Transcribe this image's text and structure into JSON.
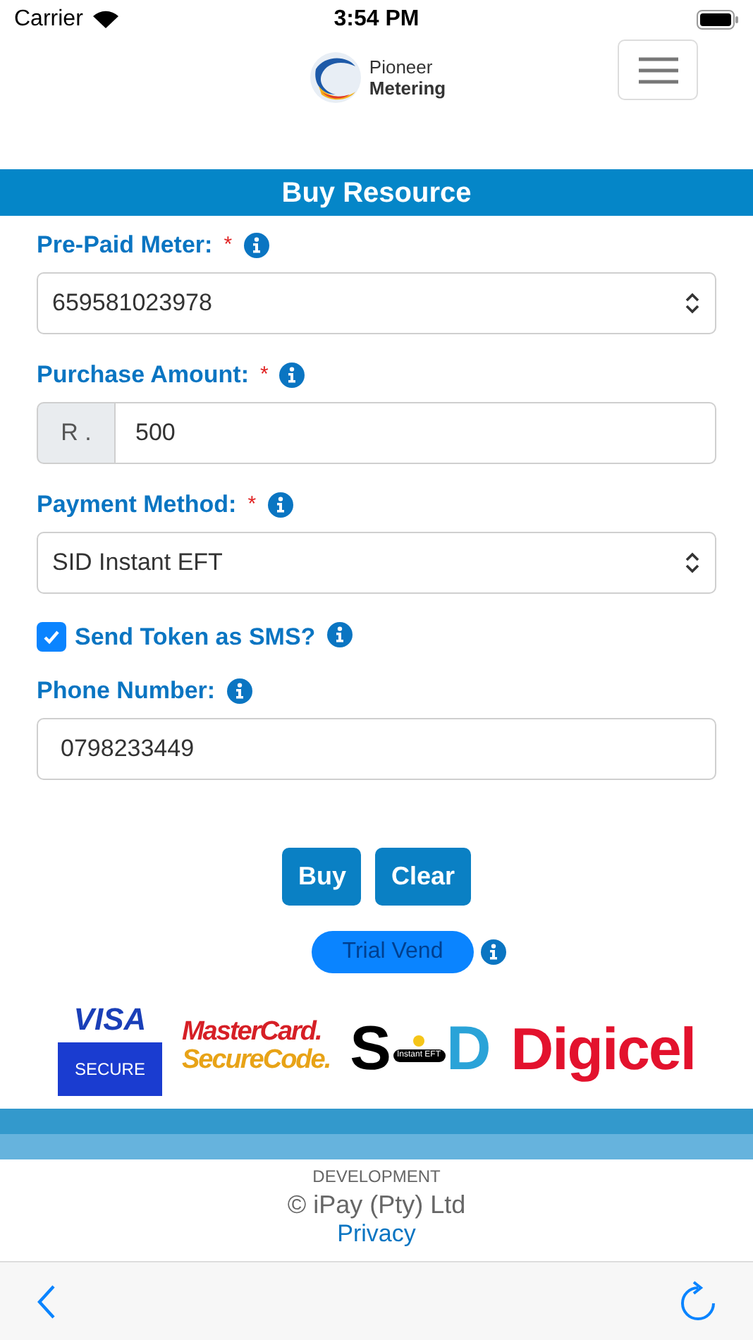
{
  "status_bar": {
    "carrier": "Carrier",
    "time": "3:54 PM"
  },
  "header": {
    "brand_top": "Pioneer",
    "brand_bottom": "Metering"
  },
  "title": "Buy Resource",
  "fields": [
    {
      "kind": "select",
      "label": "Pre-Paid Meter:",
      "required_mark": "*",
      "value": "659581023978"
    },
    {
      "kind": "prefix",
      "label": "Purchase Amount:",
      "required_mark": "*",
      "prefix": "R .",
      "value": "500"
    },
    {
      "kind": "select",
      "label": "Payment Method:",
      "required_mark": "*",
      "value": "SID Instant EFT"
    },
    {
      "kind": "checkbox",
      "label": "Send Token as SMS?",
      "checked": true
    },
    {
      "kind": "input",
      "label": "Phone Number:",
      "value": "0798233449"
    }
  ],
  "buttons": [
    "Buy",
    "Clear"
  ],
  "trial_button": "Trial Vend",
  "payment_logos": {
    "visa": "VISA",
    "visa_secure": "SECURE",
    "mastercard": "MasterCard.",
    "securecode": "SecureCode.",
    "sid_s": "S",
    "sid_badge": "Instant EFT",
    "sid_d": "D",
    "digicel": "Digicel"
  },
  "footer": {
    "environment": "DEVELOPMENT",
    "copyright": "© iPay (Pty) Ltd",
    "link": "Privacy"
  }
}
